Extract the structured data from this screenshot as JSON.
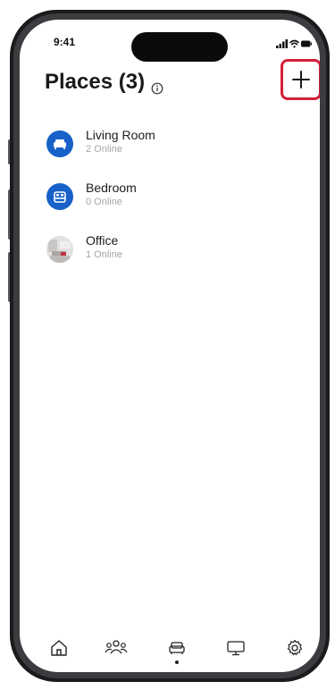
{
  "status_bar": {
    "time": "9:41",
    "signal_icon": "cellular-signal-icon",
    "wifi_icon": "wifi-icon",
    "battery_icon": "battery-icon"
  },
  "header": {
    "title": "Places (3)",
    "info_icon": "info-icon",
    "add_icon": "plus-icon",
    "add_highlight_color": "#d61f3b"
  },
  "places": [
    {
      "name": "Living Room",
      "status": "2 Online",
      "icon": "sofa-icon",
      "icon_bg": "#1761c9"
    },
    {
      "name": "Bedroom",
      "status": "0 Online",
      "icon": "bed-icon",
      "icon_bg": "#1761c9"
    },
    {
      "name": "Office",
      "status": "1 Online",
      "icon": "office-photo",
      "icon_bg": "#d9d9d9"
    }
  ],
  "bottom_nav": {
    "items": [
      {
        "icon": "home-icon",
        "active": false
      },
      {
        "icon": "people-icon",
        "active": false
      },
      {
        "icon": "sofa-icon",
        "active": true
      },
      {
        "icon": "monitor-icon",
        "active": false
      },
      {
        "icon": "gear-icon",
        "active": false
      }
    ]
  },
  "accent_color": "#1761c9"
}
